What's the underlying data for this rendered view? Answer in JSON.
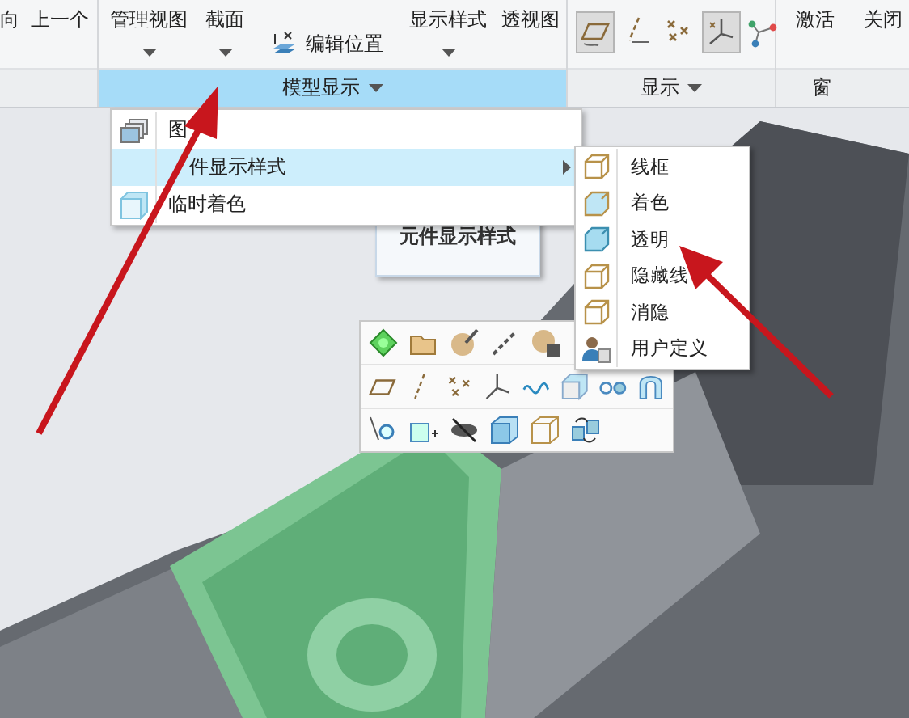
{
  "ribbon": {
    "left_buttons": [
      {
        "label": "向"
      },
      {
        "label": "上一个"
      }
    ],
    "model_display": {
      "label": "模型显示",
      "selected": true,
      "buttons": [
        {
          "kind": "dropdown",
          "label": "管理视图"
        },
        {
          "kind": "dropdown",
          "label": "截面"
        },
        {
          "kind": "small",
          "label": "编辑位置"
        },
        {
          "kind": "dropdown",
          "label": "显示样式"
        },
        {
          "kind": "plain",
          "label": "透视图"
        }
      ]
    },
    "display": {
      "label": "显示",
      "selected": false,
      "toggles": [
        {
          "kind": "plane",
          "selected": true
        },
        {
          "kind": "axis",
          "selected": false
        },
        {
          "kind": "point",
          "selected": false
        },
        {
          "kind": "csys",
          "selected": true
        },
        {
          "kind": "spin",
          "selected": false
        }
      ]
    },
    "window": {
      "label": "窗",
      "buttons": [
        {
          "label": "激活"
        },
        {
          "label": "关闭"
        }
      ]
    }
  },
  "menu": {
    "items": [
      {
        "kind": "layers",
        "label": "图",
        "selected": false,
        "submenu": false
      },
      {
        "kind": "none",
        "label": "件显示样式",
        "selected": true,
        "submenu": true
      },
      {
        "kind": "shade",
        "label": "临时着色",
        "selected": false,
        "submenu": false
      }
    ]
  },
  "tooltip": {
    "text": "元件显示样式"
  },
  "submenu": {
    "items": [
      {
        "kind": "wireframe",
        "label": "线框"
      },
      {
        "kind": "shaded",
        "label": "着色"
      },
      {
        "kind": "transparent",
        "label": "透明"
      },
      {
        "kind": "hidden",
        "label": "隐藏线"
      },
      {
        "kind": "nohidden",
        "label": "消隐"
      },
      {
        "kind": "user",
        "label": "用户定义"
      }
    ]
  }
}
